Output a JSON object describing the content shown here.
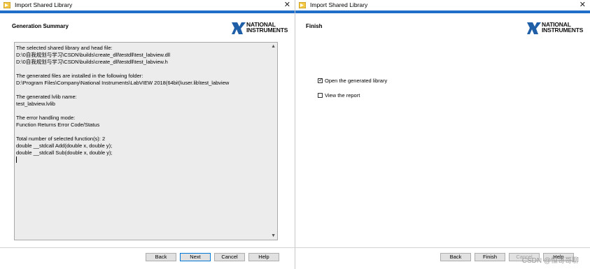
{
  "left": {
    "title": "Import Shared Library",
    "step_title": "Generation Summary",
    "logo": [
      "NATIONAL",
      "INSTRUMENTS"
    ],
    "summary_lines": [
      "The selected shared library and head file:",
      "D:\\0自我规划与学习\\CSDN\\builds\\create_dll\\testdll\\test_labview.dll",
      "D:\\0自我规划与学习\\CSDN\\builds\\create_dll\\testdll\\test_labview.h",
      "",
      "The generated files are installed in the following folder:",
      "D:\\Program Files\\Company\\National Instruments\\LabVIEW 2018(64bit)\\user.lib\\test_labview",
      "",
      "The generated lvlib name:",
      "test_labview.lvlib",
      "",
      "The error handling mode:",
      "Function Returns Error Code/Status",
      "",
      "Total number of selected function(s): 2",
      "double __stdcall Add(double x, double y);",
      "double __stdcall Sub(double x, double y);"
    ],
    "buttons": {
      "back": "Back",
      "next": "Next",
      "cancel": "Cancel",
      "help": "Help"
    }
  },
  "right": {
    "title": "Import Shared Library",
    "step_title": "Finish",
    "logo": [
      "NATIONAL",
      "INSTRUMENTS"
    ],
    "options": [
      {
        "label": "Open the generated library",
        "checked": true
      },
      {
        "label": "View the report",
        "checked": false
      }
    ],
    "buttons": {
      "back": "Back",
      "finish": "Finish",
      "cancel": "Cancel",
      "help": "Help"
    }
  },
  "watermark": "CSDN @恒哥哥聊"
}
